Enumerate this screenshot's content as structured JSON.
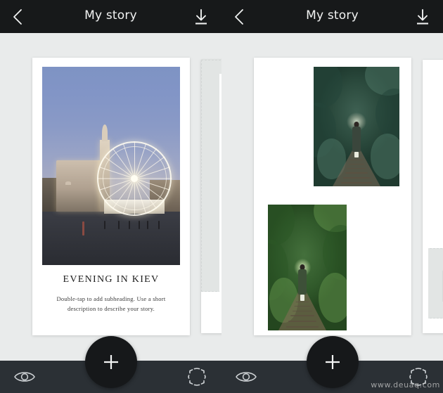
{
  "app": {
    "background_color": "#e9ebeb",
    "header_color": "#17191a",
    "toolbar_color": "#2b3035",
    "fab_color": "#16181a"
  },
  "panels": [
    {
      "id": "left",
      "header": {
        "title": "My story",
        "back_icon": "chevron-left-icon",
        "download_icon": "download-icon"
      },
      "card": {
        "caption_title": "EVENING IN KIEV",
        "caption_subtitle": "Double-tap to add subheading. Use a short description to describe your story.",
        "photo_name": "evening-in-kiev-ferris-wheel-photo"
      },
      "toolbar": {
        "preview_icon": "eye-icon",
        "add_label": "+",
        "expand_icon": "crop-frame-icon"
      }
    },
    {
      "id": "right",
      "header": {
        "title": "My story",
        "back_icon": "chevron-left-icon",
        "download_icon": "download-icon"
      },
      "card": {
        "caption_title": "",
        "caption_subtitle": "",
        "photo_name_top": "tunnel-of-love-teal-photo",
        "photo_name_bottom": "tunnel-of-love-green-photo"
      },
      "toolbar": {
        "preview_icon": "eye-icon",
        "add_label": "+",
        "expand_icon": "crop-frame-icon"
      }
    }
  ],
  "watermark": {
    "text": "www.deuaq.com"
  }
}
